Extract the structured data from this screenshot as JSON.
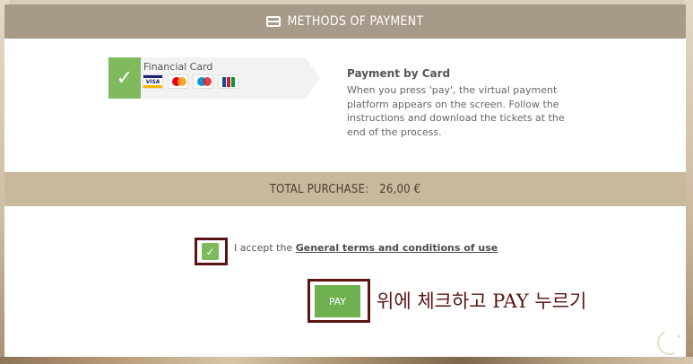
{
  "header": {
    "icon": "credit-card-icon",
    "title": "METHODS OF PAYMENT"
  },
  "payment_method": {
    "label": "Financial Card",
    "selected": true,
    "check_icon": "checkmark-icon",
    "card_logos": [
      "visa-logo",
      "mastercard-logo",
      "maestro-logo",
      "jcb-logo"
    ]
  },
  "info": {
    "title": "Payment by Card",
    "text": "When you press 'pay', the virtual payment platform appears on the screen. Follow the instructions and download the tickets at the end of the process."
  },
  "total": {
    "label": "TOTAL PURCHASE:",
    "amount": "26,00 €"
  },
  "terms": {
    "checked": true,
    "prefix": "I accept the",
    "link_text": "General terms and conditions of use"
  },
  "pay_button": {
    "label": "PAY"
  },
  "annotation": {
    "text": "위에 체크하고 PAY 누르기"
  },
  "colors": {
    "header_bg": "#a89a89",
    "total_bg": "#c8b99c",
    "accent_green": "#7fba5e",
    "annotation_red": "#5b1414"
  }
}
